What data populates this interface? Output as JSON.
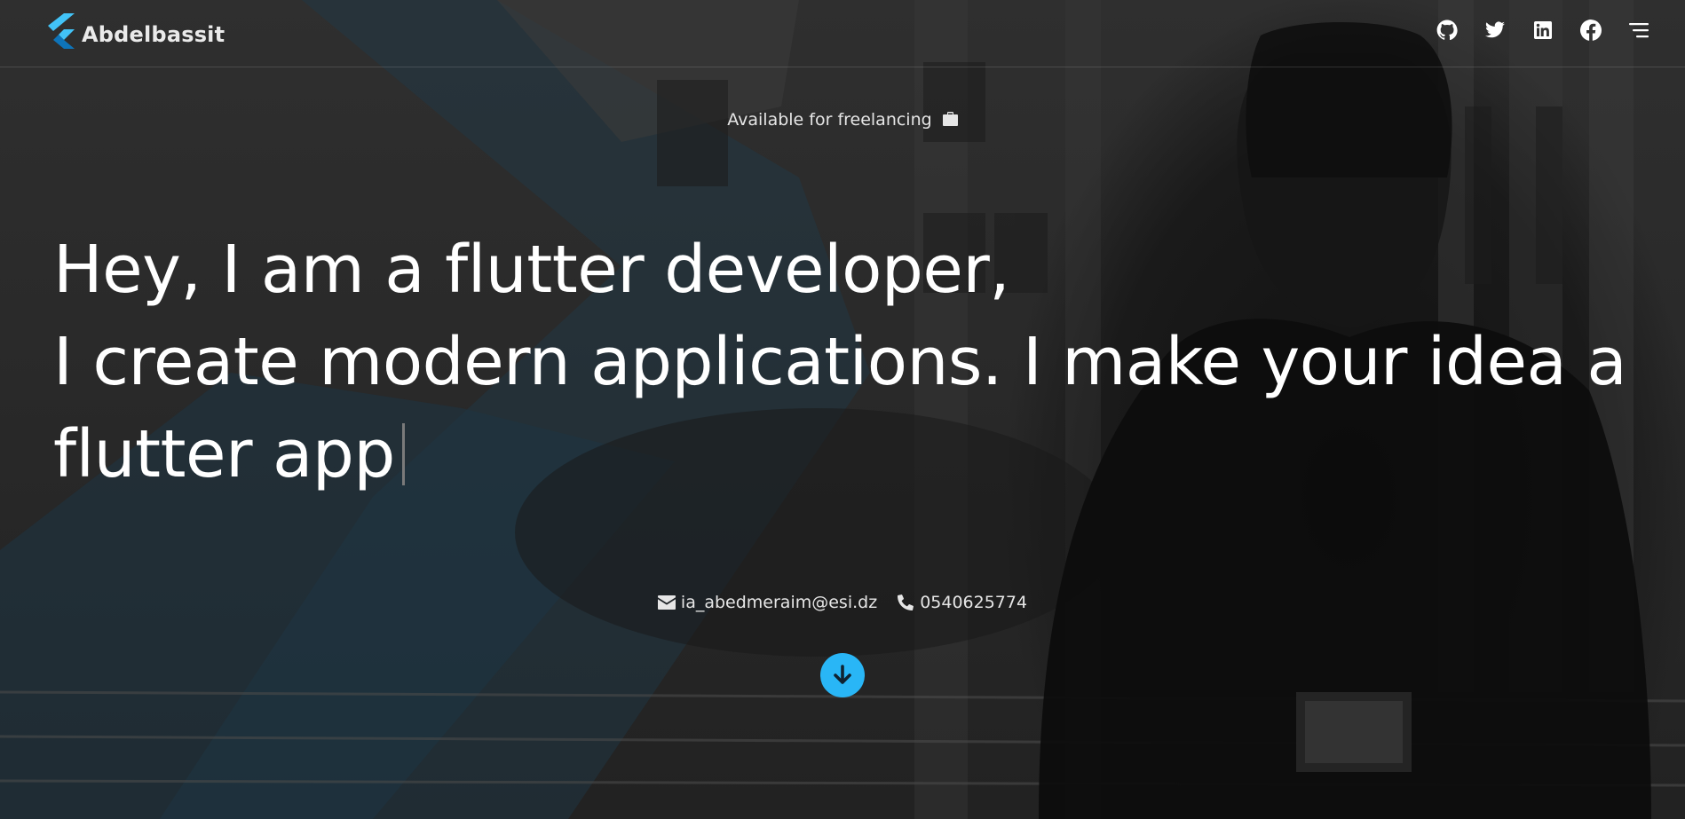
{
  "brand": {
    "name": "Abdelbassit",
    "logo_icon": "flutter-logo-icon",
    "logo_color": "#42c3f7"
  },
  "nav": {
    "icons": [
      "github-icon",
      "twitter-icon",
      "linkedin-icon",
      "facebook-icon",
      "menu-icon"
    ]
  },
  "hero": {
    "availability": "Available for freelancing",
    "availability_icon": "briefcase-icon",
    "headline_line1": "Hey, I am a flutter developer,",
    "headline_line2": "I create modern applications. I make your idea a",
    "headline_line3": "flutter app"
  },
  "contact": {
    "email": "ia_abedmeraim@esi.dz",
    "email_icon": "envelope-icon",
    "phone": "0540625774",
    "phone_icon": "phone-icon"
  },
  "scroll_button": {
    "icon": "arrow-down-icon",
    "color": "#29b6f6"
  },
  "theme": {
    "accent": "#29b6f6",
    "background": "#242424",
    "text": "#ffffff"
  }
}
